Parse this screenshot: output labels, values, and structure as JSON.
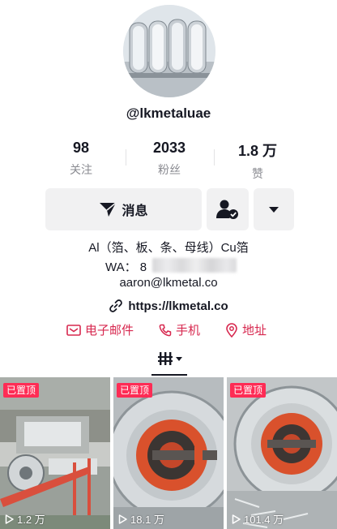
{
  "profile": {
    "username": "@lkmetaluae",
    "avatar_icon": "metal-coil-avatar"
  },
  "stats": [
    {
      "value": "98",
      "label": "关注"
    },
    {
      "value": "2033",
      "label": "粉丝"
    },
    {
      "value": "1.8 万",
      "label": "赞"
    }
  ],
  "actions": {
    "message_label": "消息",
    "message_icon": "send-icon",
    "add_friend_icon": "person-check-icon",
    "more_icon": "caret-down-icon"
  },
  "bio": {
    "line1": "Al（箔、板、条、母线）Cu箔",
    "wa_prefix": "WA：  8",
    "email": "aaron@lkmetal.co",
    "website": "https://lkmetal.co"
  },
  "contacts": {
    "email_label": "电子邮件",
    "phone_label": "手机",
    "address_label": "地址"
  },
  "videos": [
    {
      "badge": "已置顶",
      "views": "1.2 万"
    },
    {
      "badge": "已置顶",
      "views": "18.1 万"
    },
    {
      "badge": "已置顶",
      "views": "101.4 万"
    }
  ],
  "colors": {
    "accent": "#fe2c55",
    "contact_red": "#d7284f",
    "button_bg": "#f1f1f2",
    "text": "#161823",
    "muted": "#8a8b91"
  }
}
